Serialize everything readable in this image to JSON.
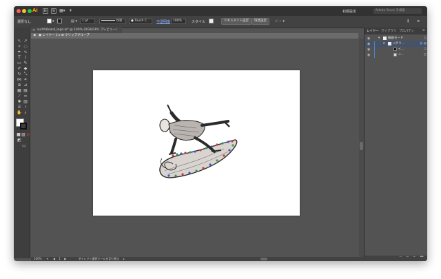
{
  "titlebar": {
    "app_logo": "Ai",
    "workspace": "初期設定",
    "stock_search_placeholder": "Adobe Stock を検索"
  },
  "controlbar": {
    "selection_label": "選択なし",
    "stroke_weight": "1 pt",
    "stroke_profile": "均等",
    "brush": "Touch C...",
    "opacity_label": "不透明度",
    "opacity_value": "100%",
    "style_label": "スタイル",
    "document_setup": "ドキュメント設定",
    "preferences": "環境設定"
  },
  "document_tab": {
    "title": "surfAiBoard_logo.ai* @ 100% (RGB/GPU プレビュー)",
    "close": "×"
  },
  "isolation_bar": {
    "layer": "レイヤー 1",
    "group": "クリップグループ"
  },
  "panels": {
    "tabs": [
      "レイヤー",
      "ライブラリ",
      "プロパティ"
    ],
    "layers": [
      {
        "name": "描画モード",
        "visible": true
      },
      {
        "name": "<グリ...",
        "visible": true
      },
      {
        "name": "<...",
        "visible": true
      },
      {
        "name": "<...",
        "visible": true
      }
    ]
  },
  "statusbar": {
    "zoom": "100%",
    "page": "1",
    "tool_hint": "ダイレクト選択ツールを切り替え"
  },
  "colors": {
    "ai_orange": "#ff9a00",
    "selection_blue": "#4c84c9"
  }
}
